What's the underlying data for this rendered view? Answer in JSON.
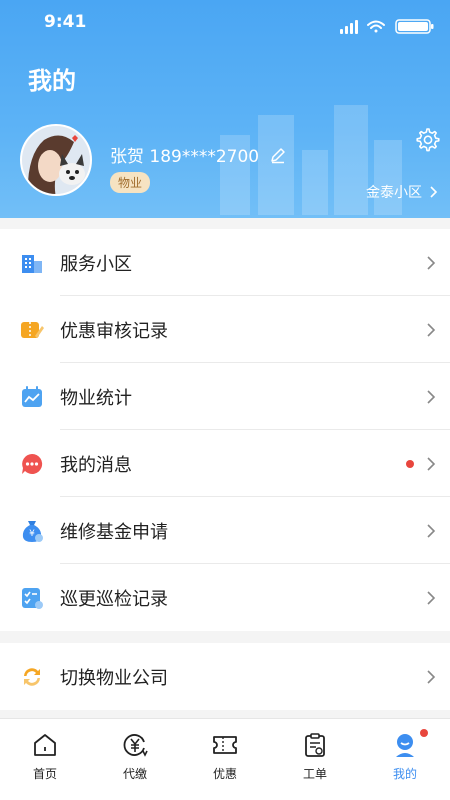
{
  "status": {
    "time": "9:41"
  },
  "header": {
    "title": "我的"
  },
  "profile": {
    "name_phone": "张贺 189****2700",
    "role": "物业",
    "community": "金泰小区"
  },
  "menu": [
    {
      "label": "服务小区",
      "icon": "building-icon",
      "has_dot": false
    },
    {
      "label": "优惠审核记录",
      "icon": "coupon-icon",
      "has_dot": false
    },
    {
      "label": "物业统计",
      "icon": "chart-calendar-icon",
      "has_dot": false
    },
    {
      "label": "我的消息",
      "icon": "message-icon",
      "has_dot": true
    },
    {
      "label": "维修基金申请",
      "icon": "money-bag-icon",
      "has_dot": false
    },
    {
      "label": "巡更巡检记录",
      "icon": "checklist-icon",
      "has_dot": false
    }
  ],
  "switch_company": {
    "label": "切换物业公司"
  },
  "tabs": [
    {
      "label": "首页",
      "icon": "home-icon"
    },
    {
      "label": "代缴",
      "icon": "yen-icon"
    },
    {
      "label": "优惠",
      "icon": "ticket-icon"
    },
    {
      "label": "工单",
      "icon": "clipboard-icon"
    },
    {
      "label": "我的",
      "icon": "user-icon",
      "active": true
    }
  ],
  "colors": {
    "accent": "#3d8ef0",
    "header": "#4aa6f3",
    "badge_red": "#e8463d"
  }
}
